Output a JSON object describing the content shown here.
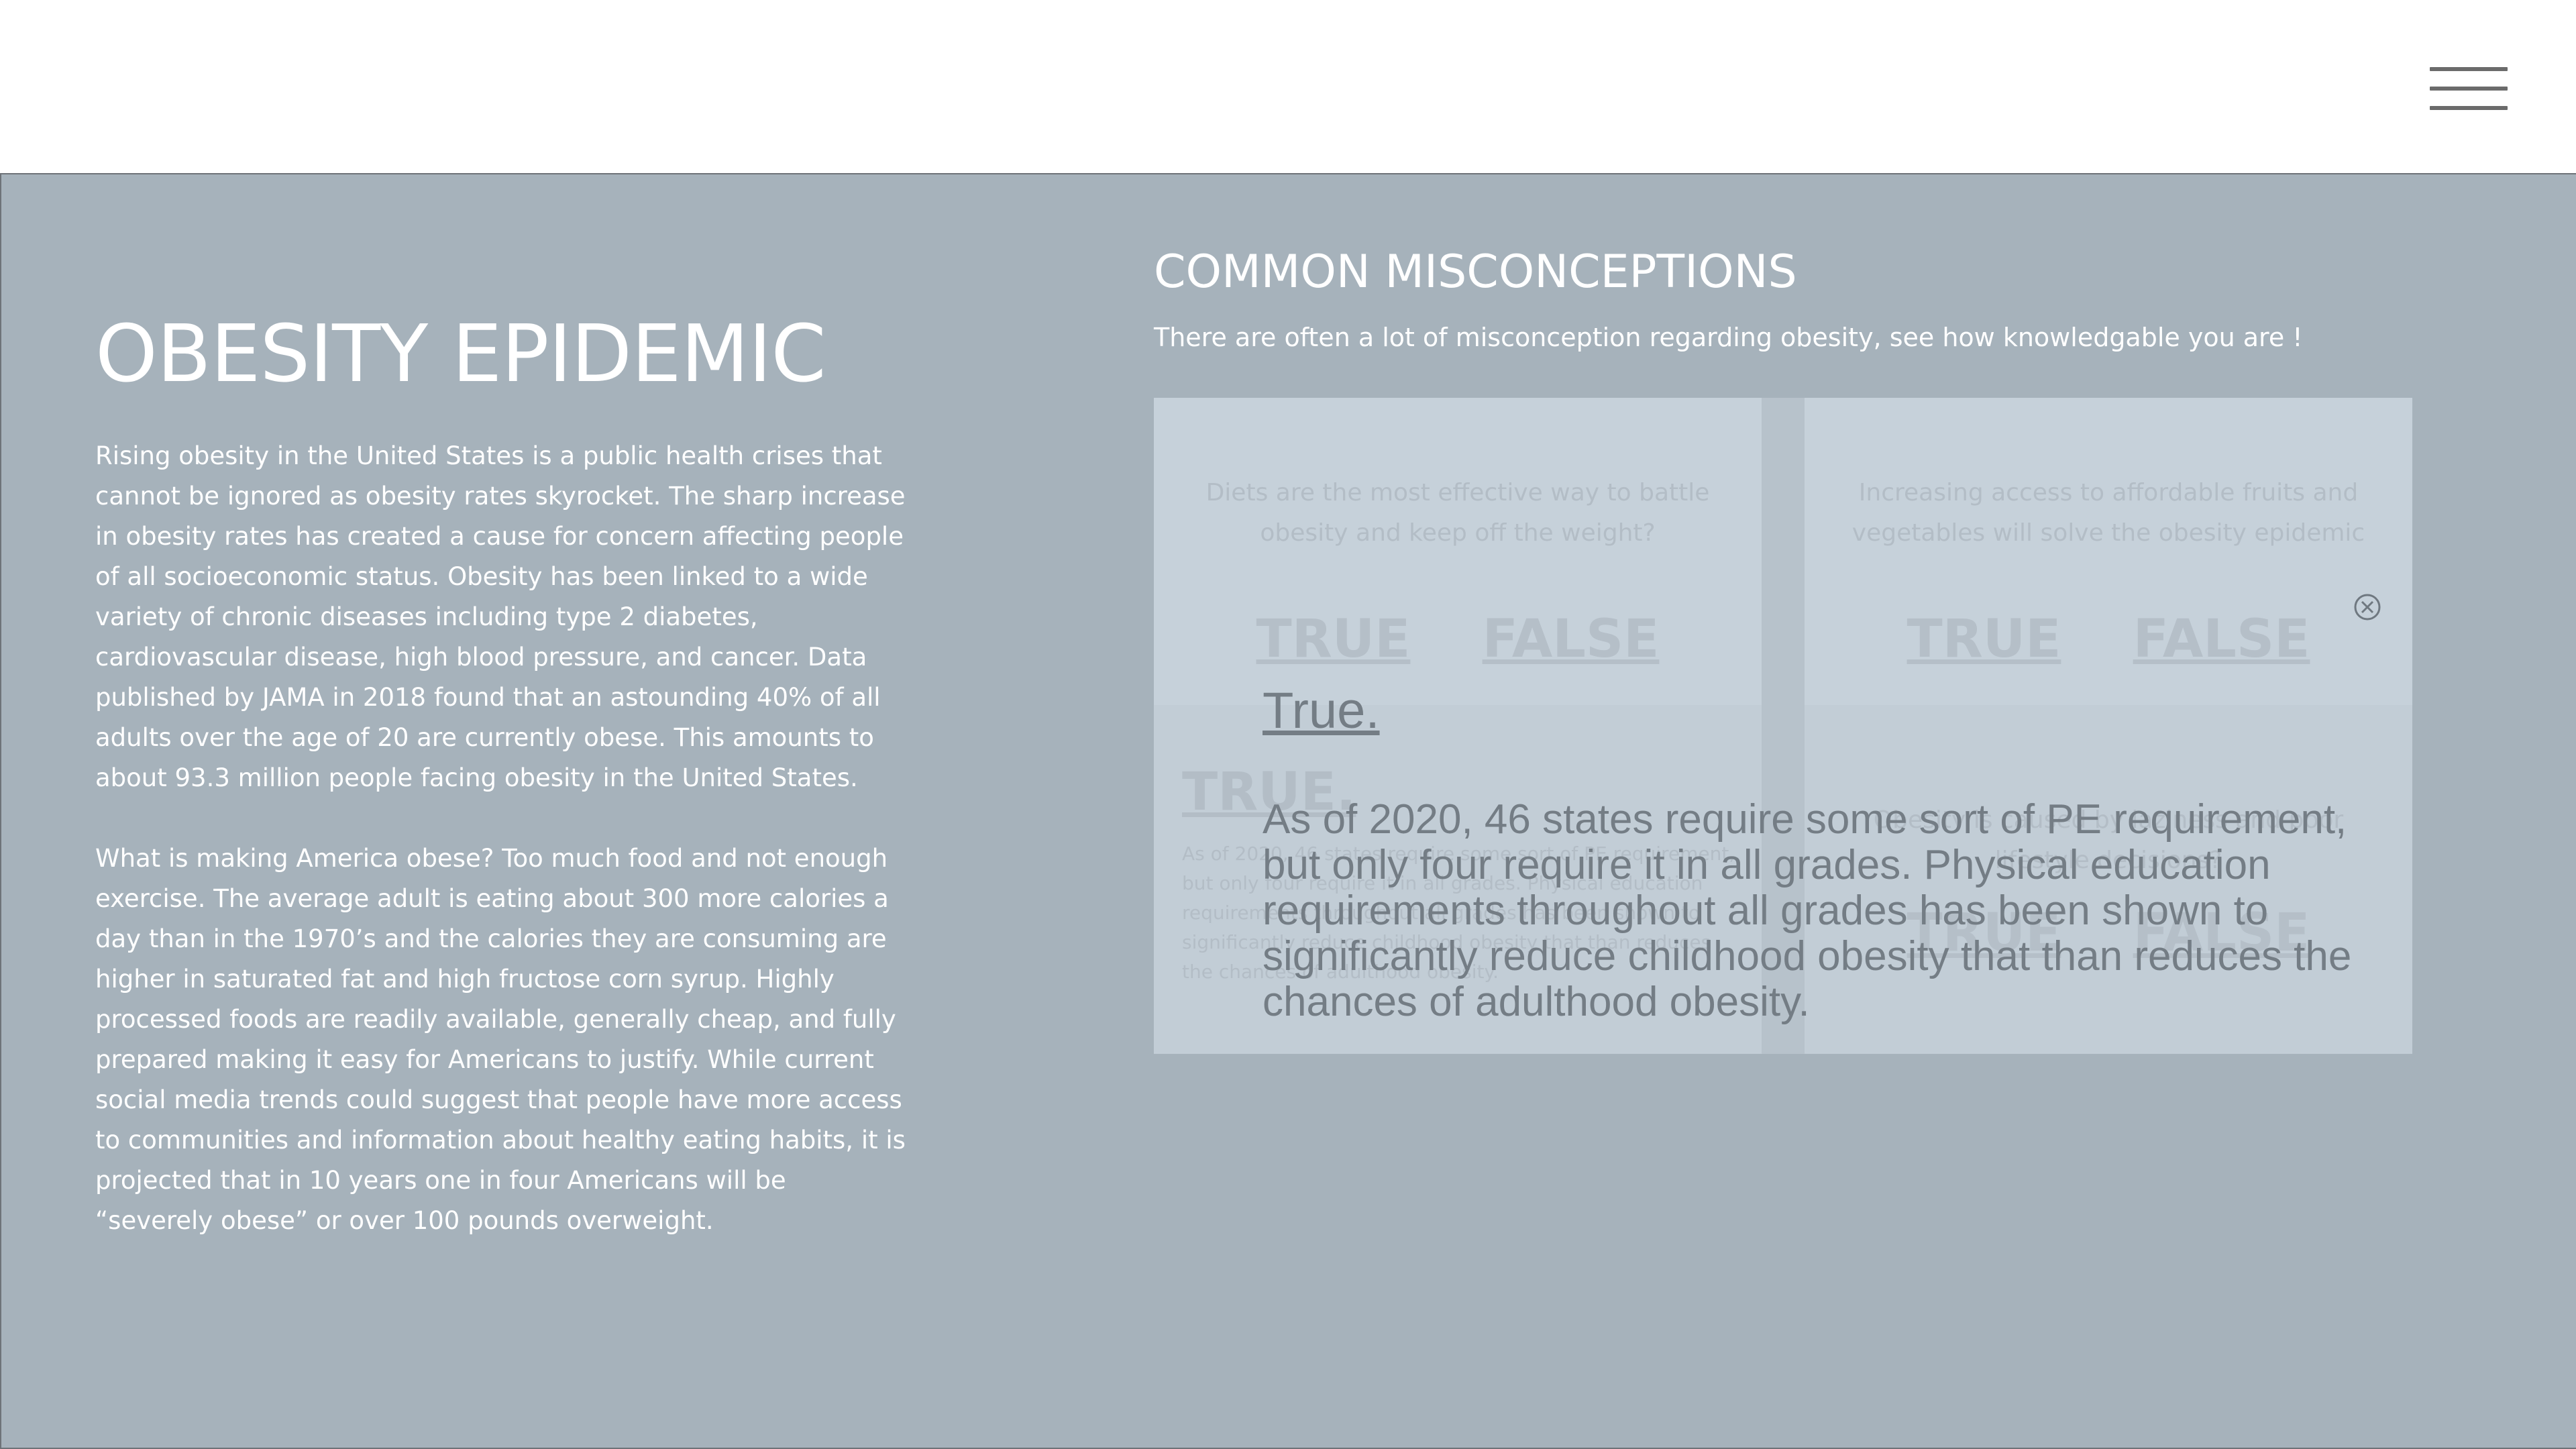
{
  "header": {
    "menu_icon": "hamburger-menu-icon"
  },
  "intro": {
    "title": "OBESITY EPIDEMIC",
    "paragraph1": "Rising obesity in the United States is a public health crises that cannot be ignored as obesity rates skyrocket. The sharp increase in obesity rates has created a cause for concern affecting people of all socioeconomic status. Obesity has been linked to a wide variety of chronic diseases including type 2 diabetes, cardiovascular disease, high blood pressure, and cancer. Data published by JAMA in 2018 found that an astounding 40% of all adults over the age of 20 are currently obese. This amounts to about 93.3 million people facing obesity in the United States.",
    "paragraph2": "What is making America obese? Too much food and not enough exercise. The average adult is eating about 300 more calories a day than in the 1970’s and the calories they are consuming are higher in saturated fat and high fructose corn syrup. Highly processed foods are readily available, generally cheap, and fully prepared making it easy for Americans to justify. While current social media trends could suggest that people have more access to communities and information about healthy eating habits, it is projected that in 10 years one in four Americans will be “severely obese” or over 100 pounds overweight."
  },
  "misconceptions": {
    "title": "COMMON MISCONCEPTIONS",
    "subtitle": "There are often a lot of misconception regarding obesity, see how knowledgable you are !",
    "cards": [
      {
        "question": "Diets are the most effective way to battle obesity and keep off the weight?",
        "true_label": "TRUE",
        "false_label": "FALSE"
      },
      {
        "question": "Increasing access to affordable fruits and vegetables will solve the obesity epidemic",
        "true_label": "TRUE",
        "false_label": "FALSE"
      },
      {
        "answer_label": "TRUE.",
        "answer_text": "As of 2020, 46 states require some sort of PE requirement, but only four require it in all grades. Physical education requirements throughout all grades has been shown to significantly reduce childhood obesity that than reduces the chances of adulthood obesity."
      },
      {
        "question": "Obesity is caused by laziness and poor lifestyle decisions?",
        "true_label": "TRUE",
        "false_label": "FALSE"
      }
    ],
    "popup": {
      "title": "True.",
      "body": "As of 2020, 46 states require some sort of PE requirement, but only four require it in all grades. Physical education requirements throughout all grades has been shown to significantly reduce childhood obesity that than reduces the chances of adulthood obesity.",
      "close_icon": "close-circle-icon"
    }
  }
}
